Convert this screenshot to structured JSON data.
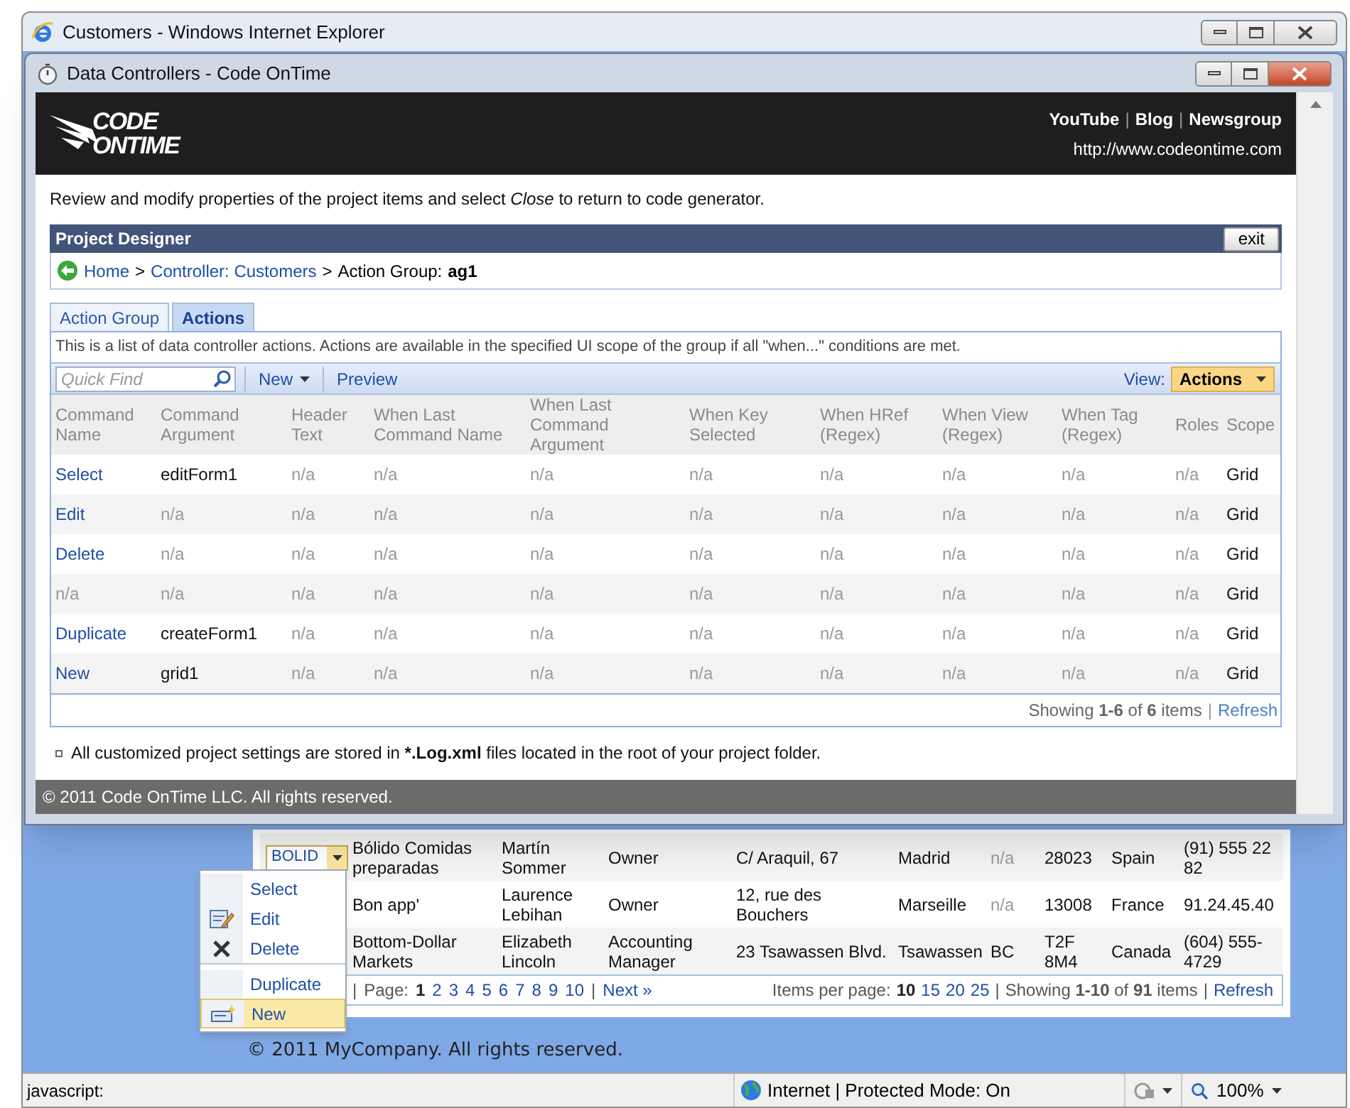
{
  "browser": {
    "title": "Customers - Windows Internet Explorer",
    "status": "javascript:",
    "zone": "Internet | Protected Mode: On",
    "zoom": "100%"
  },
  "dialog": {
    "title": "Data Controllers - Code OnTime",
    "logo": [
      "CODE",
      "ONTIME"
    ],
    "links": [
      "YouTube",
      "Blog",
      "Newsgroup"
    ],
    "link_separator": "|",
    "url": "http://www.codeontime.com",
    "intro": "Review and modify properties of the project items and select *Close* to return to code generator.",
    "designer_title": "Project Designer",
    "exit_button": "exit",
    "breadcrumb": {
      "links": [
        "Home",
        "Controller: Customers"
      ],
      "separator": ">",
      "label": "Action Group:",
      "value": "ag1"
    },
    "tabs": [
      {
        "label": "Action Group",
        "selected": false
      },
      {
        "label": "Actions",
        "selected": true
      }
    ],
    "description": "This is a list of data controller actions. Actions are available in the specified UI scope of the group if all \"when...\" conditions are met.",
    "toolbar": {
      "search_placeholder": "Quick Find",
      "new_button": "New",
      "preview_button": "Preview",
      "view_label": "View:",
      "view_value": "Actions"
    },
    "columns": [
      "Command Name",
      "Command Argument",
      "Header Text",
      "When Last Command Name",
      "When Last Command Argument",
      "When Key Selected",
      "When HRef (Regex)",
      "When View (Regex)",
      "When Tag (Regex)",
      "Roles",
      "Scope"
    ],
    "rows": [
      {
        "cells": [
          {
            "text": "Select",
            "kind": "link"
          },
          {
            "text": "editForm1",
            "kind": "value"
          },
          {
            "text": "n/a",
            "kind": "empty"
          },
          {
            "text": "n/a",
            "kind": "empty"
          },
          {
            "text": "n/a",
            "kind": "empty"
          },
          {
            "text": "n/a",
            "kind": "empty"
          },
          {
            "text": "n/a",
            "kind": "empty"
          },
          {
            "text": "n/a",
            "kind": "empty"
          },
          {
            "text": "n/a",
            "kind": "empty"
          },
          {
            "text": "n/a",
            "kind": "empty"
          },
          {
            "text": "Grid",
            "kind": "value"
          }
        ]
      },
      {
        "cells": [
          {
            "text": "Edit",
            "kind": "link"
          },
          {
            "text": "n/a",
            "kind": "empty"
          },
          {
            "text": "n/a",
            "kind": "empty"
          },
          {
            "text": "n/a",
            "kind": "empty"
          },
          {
            "text": "n/a",
            "kind": "empty"
          },
          {
            "text": "n/a",
            "kind": "empty"
          },
          {
            "text": "n/a",
            "kind": "empty"
          },
          {
            "text": "n/a",
            "kind": "empty"
          },
          {
            "text": "n/a",
            "kind": "empty"
          },
          {
            "text": "n/a",
            "kind": "empty"
          },
          {
            "text": "Grid",
            "kind": "value"
          }
        ]
      },
      {
        "cells": [
          {
            "text": "Delete",
            "kind": "link"
          },
          {
            "text": "n/a",
            "kind": "empty"
          },
          {
            "text": "n/a",
            "kind": "empty"
          },
          {
            "text": "n/a",
            "kind": "empty"
          },
          {
            "text": "n/a",
            "kind": "empty"
          },
          {
            "text": "n/a",
            "kind": "empty"
          },
          {
            "text": "n/a",
            "kind": "empty"
          },
          {
            "text": "n/a",
            "kind": "empty"
          },
          {
            "text": "n/a",
            "kind": "empty"
          },
          {
            "text": "n/a",
            "kind": "empty"
          },
          {
            "text": "Grid",
            "kind": "value"
          }
        ]
      },
      {
        "cells": [
          {
            "text": "n/a",
            "kind": "empty"
          },
          {
            "text": "n/a",
            "kind": "empty"
          },
          {
            "text": "n/a",
            "kind": "empty"
          },
          {
            "text": "n/a",
            "kind": "empty"
          },
          {
            "text": "n/a",
            "kind": "empty"
          },
          {
            "text": "n/a",
            "kind": "empty"
          },
          {
            "text": "n/a",
            "kind": "empty"
          },
          {
            "text": "n/a",
            "kind": "empty"
          },
          {
            "text": "n/a",
            "kind": "empty"
          },
          {
            "text": "n/a",
            "kind": "empty"
          },
          {
            "text": "Grid",
            "kind": "value"
          }
        ]
      },
      {
        "cells": [
          {
            "text": "Duplicate",
            "kind": "link"
          },
          {
            "text": "createForm1",
            "kind": "value"
          },
          {
            "text": "n/a",
            "kind": "empty"
          },
          {
            "text": "n/a",
            "kind": "empty"
          },
          {
            "text": "n/a",
            "kind": "empty"
          },
          {
            "text": "n/a",
            "kind": "empty"
          },
          {
            "text": "n/a",
            "kind": "empty"
          },
          {
            "text": "n/a",
            "kind": "empty"
          },
          {
            "text": "n/a",
            "kind": "empty"
          },
          {
            "text": "n/a",
            "kind": "empty"
          },
          {
            "text": "Grid",
            "kind": "value"
          }
        ]
      },
      {
        "cells": [
          {
            "text": "New",
            "kind": "link"
          },
          {
            "text": "grid1",
            "kind": "value"
          },
          {
            "text": "n/a",
            "kind": "empty"
          },
          {
            "text": "n/a",
            "kind": "empty"
          },
          {
            "text": "n/a",
            "kind": "empty"
          },
          {
            "text": "n/a",
            "kind": "empty"
          },
          {
            "text": "n/a",
            "kind": "empty"
          },
          {
            "text": "n/a",
            "kind": "empty"
          },
          {
            "text": "n/a",
            "kind": "empty"
          },
          {
            "text": "n/a",
            "kind": "empty"
          },
          {
            "text": "Grid",
            "kind": "value"
          }
        ]
      }
    ],
    "pager": {
      "summary": "Showing **1-6** of **6** items",
      "separator": "|",
      "refresh": "Refresh"
    },
    "note": {
      "before": "All customized project settings are stored in",
      "bold": "*.Log.xml",
      "after": "files located in the root of your project folder."
    },
    "footer": "© 2011 Code OnTime LLC. All rights reserved."
  },
  "page": {
    "lookup_value": "BOLID",
    "rows": [
      {
        "cells": [
          {
            "text": "Bólido Comidas preparadas",
            "kind": "value"
          },
          {
            "text": "Martín Sommer",
            "kind": "value"
          },
          {
            "text": "Owner",
            "kind": "value"
          },
          {
            "text": "C/ Araquil, 67",
            "kind": "value"
          },
          {
            "text": "Madrid",
            "kind": "value"
          },
          {
            "text": "n/a",
            "kind": "empty"
          },
          {
            "text": "28023",
            "kind": "value"
          },
          {
            "text": "Spain",
            "kind": "value"
          },
          {
            "text": "(91) 555 22 82",
            "kind": "value"
          }
        ]
      },
      {
        "cells": [
          {
            "text": "Bon app'",
            "kind": "value"
          },
          {
            "text": "Laurence Lebihan",
            "kind": "value"
          },
          {
            "text": "Owner",
            "kind": "value"
          },
          {
            "text": "12, rue des Bouchers",
            "kind": "value"
          },
          {
            "text": "Marseille",
            "kind": "value"
          },
          {
            "text": "n/a",
            "kind": "empty"
          },
          {
            "text": "13008",
            "kind": "value"
          },
          {
            "text": "France",
            "kind": "value"
          },
          {
            "text": "91.24.45.40",
            "kind": "value"
          }
        ]
      },
      {
        "cells": [
          {
            "text": "Bottom-Dollar Markets",
            "kind": "value"
          },
          {
            "text": "Elizabeth Lincoln",
            "kind": "value"
          },
          {
            "text": "Accounting Manager",
            "kind": "value"
          },
          {
            "text": "23 Tsawassen Blvd.",
            "kind": "value"
          },
          {
            "text": "Tsawassen",
            "kind": "value"
          },
          {
            "text": "BC",
            "kind": "value"
          },
          {
            "text": "T2F 8M4",
            "kind": "value"
          },
          {
            "text": "Canada",
            "kind": "value"
          },
          {
            "text": "(604) 555-4729",
            "kind": "value"
          }
        ]
      }
    ],
    "pager": {
      "separator": "|",
      "page_label": "Page:",
      "pages": [
        {
          "label": "1",
          "selected": true
        },
        {
          "label": "2",
          "selected": false
        },
        {
          "label": "3",
          "selected": false
        },
        {
          "label": "4",
          "selected": false
        },
        {
          "label": "5",
          "selected": false
        },
        {
          "label": "6",
          "selected": false
        },
        {
          "label": "7",
          "selected": false
        },
        {
          "label": "8",
          "selected": false
        },
        {
          "label": "9",
          "selected": false
        },
        {
          "label": "10",
          "selected": false
        }
      ],
      "next": "Next »",
      "per_page_label": "Items per page:",
      "per_page": [
        {
          "label": "10",
          "selected": true
        },
        {
          "label": "15",
          "selected": false
        },
        {
          "label": "20",
          "selected": false
        },
        {
          "label": "25",
          "selected": false
        }
      ],
      "summary": "Showing **1-10** of **91** items",
      "refresh": "Refresh"
    },
    "footer": "© 2011 MyCompany. All rights reserved."
  },
  "menu": [
    {
      "label": "Select",
      "kind": "plain",
      "separator_before": false,
      "selected": false
    },
    {
      "label": "Edit",
      "kind": "edit",
      "separator_before": false,
      "selected": false
    },
    {
      "label": "Delete",
      "kind": "delete",
      "separator_before": false,
      "selected": false
    },
    {
      "label": "Duplicate",
      "kind": "plain",
      "separator_before": true,
      "selected": false
    },
    {
      "label": "New",
      "kind": "new",
      "separator_before": false,
      "selected": true
    }
  ]
}
